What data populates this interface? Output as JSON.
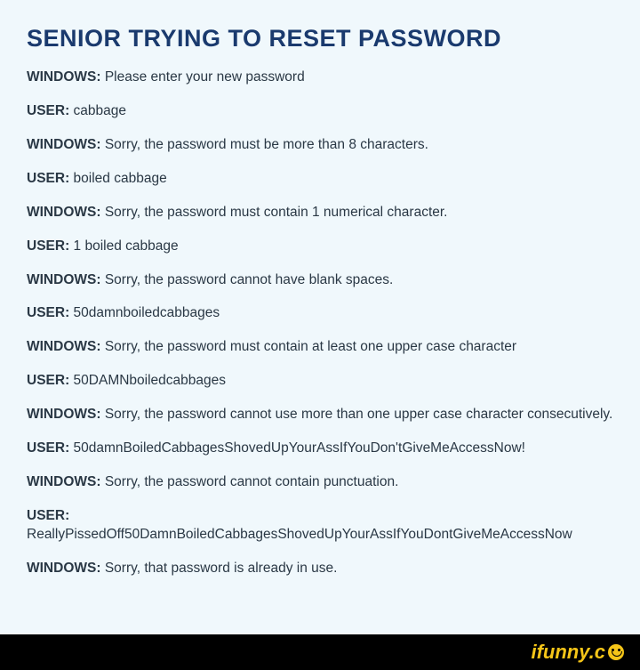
{
  "title": "SENIOR TRYING TO RESET PASSWORD",
  "dialogue": [
    {
      "speaker": "WINDOWS:",
      "text": " Please enter your new password"
    },
    {
      "speaker": "USER:",
      "text": " cabbage"
    },
    {
      "speaker": "WINDOWS:",
      "text": " Sorry, the password must be more than 8 characters."
    },
    {
      "speaker": "USER:",
      "text": " boiled cabbage"
    },
    {
      "speaker": "WINDOWS:",
      "text": " Sorry, the password must contain 1 numerical  character."
    },
    {
      "speaker": "USER:",
      "text": " 1 boiled cabbage"
    },
    {
      "speaker": "WINDOWS:",
      "text": " Sorry, the password cannot have blank spaces."
    },
    {
      "speaker": "USER:",
      "text": " 50damnboiledcabbages"
    },
    {
      "speaker": "WINDOWS:",
      "text": " Sorry, the password must contain at least one upper case character"
    },
    {
      "speaker": "USER:",
      "text": " 50DAMNboiledcabbages"
    },
    {
      "speaker": "WINDOWS:",
      "text": " Sorry, the password cannot use more than one upper case character consecutively."
    },
    {
      "speaker": "USER:",
      "text": " 50damnBoiledCabbagesShovedUpYourAssIfYouDon'tGiveMeAccessNow!"
    },
    {
      "speaker": "WINDOWS:",
      "text": " Sorry, the password cannot contain punctuation."
    },
    {
      "speaker": "USER:",
      "text": " ReallyPissedOff50DamnBoiledCabbagesShovedUpYourAssIfYouDontGiveMeAccessNow"
    },
    {
      "speaker": "WINDOWS:",
      "text": " Sorry, that password is already in use."
    }
  ],
  "watermark": "ifunny.c"
}
